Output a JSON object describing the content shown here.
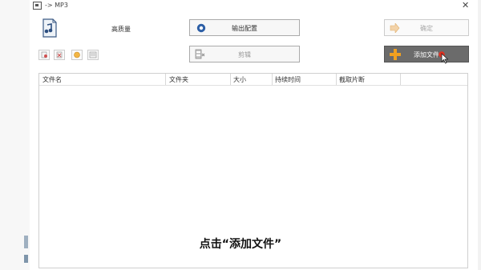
{
  "window": {
    "title": "-> MP3",
    "close_glyph": "✕"
  },
  "format": {
    "quality_label": "高质量",
    "icon": "mp3-format-icon"
  },
  "buttons": {
    "output_config": "输出配置",
    "clip": "剪辑",
    "confirm": "确定",
    "add_file": "添加文件"
  },
  "toolbar": {
    "icons": [
      "remove-file-icon",
      "clear-list-icon",
      "option-icon",
      "media-info-icon"
    ]
  },
  "table": {
    "columns": [
      "文件名",
      "文件夹",
      "大小",
      "持续时间",
      "截取片断"
    ],
    "rows": []
  },
  "subtitle": "点击“添加文件”",
  "colors": {
    "add_button_bg": "#6b6b6b",
    "add_plus": "#f0a020",
    "cursor_badge": "#e03020"
  }
}
